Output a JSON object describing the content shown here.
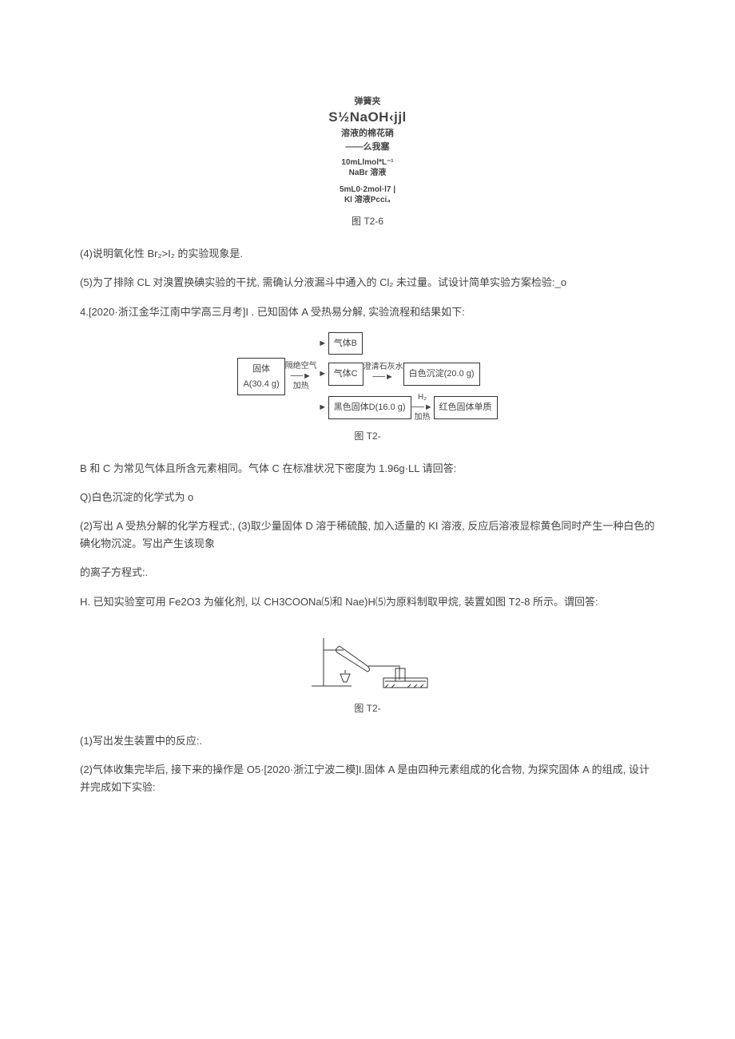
{
  "fig1": {
    "line1": "弹簧夹",
    "line2": "S½NaOH‹jjl",
    "line3": "溶液的棉花硝",
    "line4": "――么我塞",
    "line5": "10mLlmol*L⁻¹",
    "line6": "NaBr 溶液",
    "line7": "5mL0·2mol·l7 |",
    "line8": "Kl 溶液Pcci₄"
  },
  "caption1": "图 T2-6",
  "q4": "(4)说明氧化性 Br₂>I₂ 的实验现象是.",
  "q5": "(5)为了排除 CL 对溴置换碘实验的干扰, 需确认分液漏斗中通入的 Cl₂ 未过量。试设计简单实验方案检验:_o",
  "p4_intro": "4.[2020·浙江金华江南中学高三月考]I . 已知固体 A 受热易分解, 实验流程和结果如下:",
  "flow": {
    "leftTop": "固体",
    "leftBottom": "A(30.4 g)",
    "midTop": "隔绝空气",
    "midBottom": "加热",
    "r1": "气体B",
    "r2": "气体C",
    "r2_mid": "澄清石灰水",
    "r2_right": "白色沉淀(20.0 g)",
    "r3": "黑色固体D(16.0 g)",
    "r3_midTop": "H₂",
    "r3_midBottom": "加热",
    "r3_right": "红色固体单质"
  },
  "caption2": "图 T2-",
  "p4_after": "B 和 C 为常见气体且所含元素相同。气体 C 在标准状况下密度为 1.96g·LL 请回答:",
  "q4_1": "Q)白色沉淀的化学式为 o",
  "q4_2": "(2)写出 A 受热分解的化学方程式:, (3)取少量固体 D 溶于稀硫酸, 加入适量的 KI 溶液, 反应后溶液显棕黄色同时产生一种白色的碘化物沉淀。写出产生该现象",
  "q4_3": "的离子方程式:.",
  "p4_II": "H. 已知实验室可用 Fe2O3 为催化剂, 以 CH3COONa⑸和 Nae)H⑸为原料制取甲烷, 装置如图 T2-8 所示。谓回答:",
  "caption3": "图 T2-",
  "q4_II_1": "(1)写出发生装置中的反应:.",
  "q4_II_2": "(2)气体收集完毕后, 接下来的操作是 O5·[2020·浙江宁波二模]I.固体 A 是由四种元素组成的化合物, 为探究固体 A 的组成, 设计并完成如下实验:"
}
